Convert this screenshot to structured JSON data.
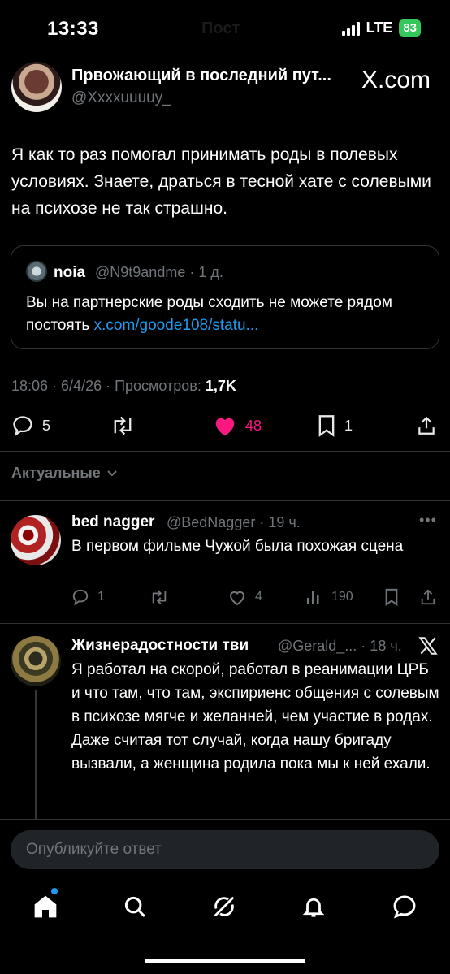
{
  "status_bar": {
    "time": "13:33",
    "network": "LTE",
    "battery": "83"
  },
  "ghost_title": "Пост",
  "post": {
    "author_name": "Првожающий в последний пут...",
    "author_handle": "@Xxxxuuuuy_",
    "brand": "X.com",
    "text": "Я как то раз помогал принимать роды в полевых условиях. Знаете, драться в тесной хате с солевыми на психозе не так страшно.",
    "quote": {
      "name": "noia",
      "handle_time": "@N9t9andme · 1 д.",
      "text": "Вы на партнерские роды сходить не можете рядом постоять",
      "link": "x.com/goode108/statu..."
    },
    "meta_prefix": "18:06 · 6/4/26 · Просмотров: ",
    "views": "1,7K",
    "stats": {
      "replies": "5",
      "reposts": "",
      "likes": "48",
      "bookmarks": "1"
    }
  },
  "relevance_label": "Актуальные",
  "replies": [
    {
      "name": "bed nagger",
      "handle_time": "@BedNagger · 19 ч.",
      "text": "В первом фильме Чужой была похожая сцена",
      "stats": {
        "replies": "1",
        "likes": "4",
        "views": "190"
      }
    },
    {
      "name": "Жизнерадостности тви",
      "handle_time": "@Gerald_... · 18 ч.",
      "text_lines": [
        "Я работал на скорой, работал в реанимации ЦРБ и что там, что там, экспириенс общения с солевым в психозе мягче и желанней, чем участие в родах.",
        "Даже считая тот случай, когда нашу бригаду вызвали, а женщина родила пока мы к ней ехали."
      ]
    }
  ],
  "composer": {
    "placeholder": "Опубликуйте ответ"
  },
  "colors": {
    "accent": "#1d9bf0",
    "like": "#f91880",
    "battery": "#34c759"
  },
  "icons": [
    "home-icon",
    "search-icon",
    "grok-icon",
    "bell-icon",
    "messages-icon"
  ]
}
